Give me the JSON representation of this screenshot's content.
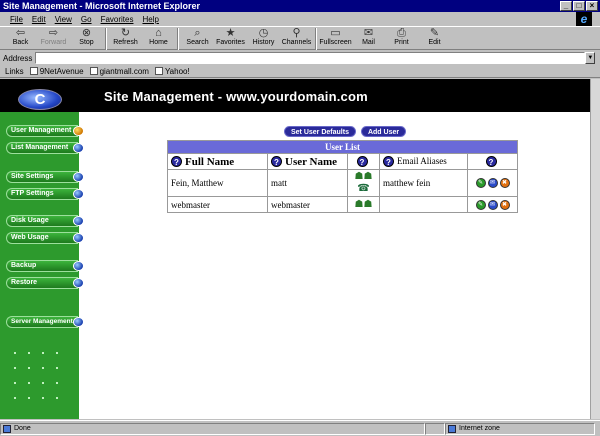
{
  "window": {
    "title": "Site Management - Microsoft Internet Explorer"
  },
  "menu": [
    "File",
    "Edit",
    "View",
    "Go",
    "Favorites",
    "Help"
  ],
  "toolbar": [
    {
      "label": "Back",
      "icon": "back-icon",
      "glyph": "⇦",
      "disabled": false
    },
    {
      "label": "Forward",
      "icon": "forward-icon",
      "glyph": "⇨",
      "disabled": true
    },
    {
      "label": "Stop",
      "icon": "stop-icon",
      "glyph": "⊗",
      "disabled": false
    },
    {
      "label": "Refresh",
      "icon": "refresh-icon",
      "glyph": "↻",
      "disabled": false
    },
    {
      "label": "Home",
      "icon": "home-icon",
      "glyph": "⌂",
      "disabled": false
    },
    {
      "label": "Search",
      "icon": "search-icon",
      "glyph": "⌕",
      "disabled": false
    },
    {
      "label": "Favorites",
      "icon": "favorites-icon",
      "glyph": "★",
      "disabled": false
    },
    {
      "label": "History",
      "icon": "history-icon",
      "glyph": "◷",
      "disabled": false
    },
    {
      "label": "Channels",
      "icon": "channels-icon",
      "glyph": "⚲",
      "disabled": false
    },
    {
      "label": "Fullscreen",
      "icon": "fullscreen-icon",
      "glyph": "▭",
      "disabled": false
    },
    {
      "label": "Mail",
      "icon": "mail-icon",
      "glyph": "✉",
      "disabled": false
    },
    {
      "label": "Print",
      "icon": "print-icon",
      "glyph": "⎙",
      "disabled": false
    },
    {
      "label": "Edit",
      "icon": "edit-icon",
      "glyph": "✎",
      "disabled": false
    }
  ],
  "address": {
    "label": "Address",
    "value": ""
  },
  "links": {
    "label": "Links",
    "items": [
      "9NetAvenue",
      "giantmall.com",
      "Yahoo!"
    ]
  },
  "banner": {
    "title": "Site Management - www.yourdomain.com",
    "logo_text": "C"
  },
  "sidebar": {
    "items": [
      {
        "label": "User Management",
        "active": true
      },
      {
        "label": "List Management",
        "active": false
      },
      {
        "label": "Site Settings",
        "active": false
      },
      {
        "label": "FTP Settings",
        "active": false
      },
      {
        "label": "Disk Usage",
        "active": false
      },
      {
        "label": "Web Usage",
        "active": false
      },
      {
        "label": "Backup",
        "active": false
      },
      {
        "label": "Restore",
        "active": false
      },
      {
        "label": "Server Management",
        "active": false
      }
    ]
  },
  "actions": {
    "set_defaults": "Set User Defaults",
    "add_user": "Add User"
  },
  "user_list": {
    "title": "User List",
    "headers": {
      "full_name": "Full Name",
      "user_name": "User Name",
      "email_aliases": "Email Aliases"
    },
    "help_glyph": "?",
    "rows": [
      {
        "full_name": "Fein, Matthew",
        "user_name": "matt",
        "email_aliases": "matthew fein",
        "has_phone": true,
        "has_actions": true
      },
      {
        "full_name": "webmaster",
        "user_name": "webmaster",
        "email_aliases": "",
        "has_phone": false,
        "has_actions": true
      }
    ]
  },
  "status": {
    "text": "Done",
    "zone": "Internet zone"
  },
  "colors": {
    "banner": "#000000",
    "sidebar": "#2d9a2d",
    "table_header": "#6a6ad8",
    "button": "#2a2a9a",
    "titlebar": "#000080"
  }
}
